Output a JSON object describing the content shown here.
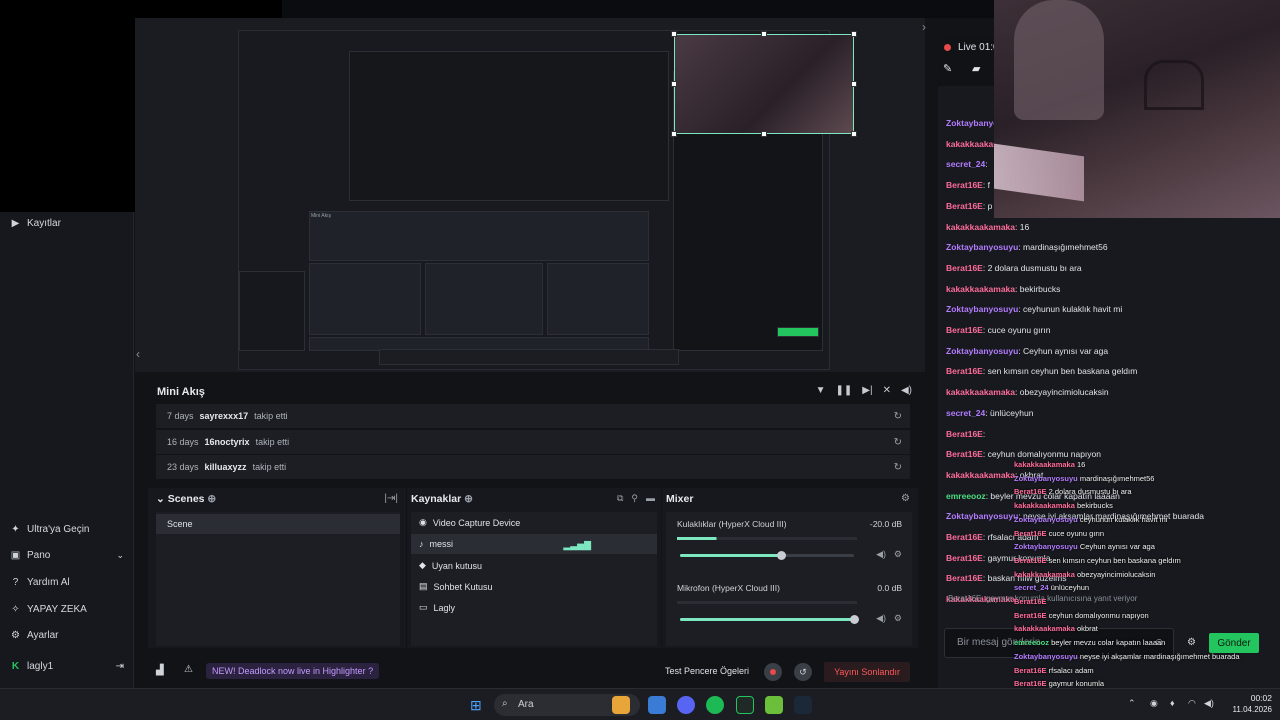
{
  "sidebar": {
    "recordings_label": "Kayıtlar",
    "items": [
      {
        "label": "Ultra'ya Geçin",
        "icon": "ultra-icon"
      },
      {
        "label": "Pano",
        "icon": "dashboard-icon"
      },
      {
        "label": "Yardım Al",
        "icon": "help-icon"
      },
      {
        "label": "YAPAY ZEKA",
        "icon": "ai-icon"
      },
      {
        "label": "Ayarlar",
        "icon": "gear-icon"
      }
    ],
    "user": "lagly1"
  },
  "mini_akis": {
    "title": "Mini Akış",
    "rows": [
      {
        "time": "7 days",
        "user": "sayrexxx17",
        "action": "takip etti"
      },
      {
        "time": "16 days",
        "user": "16noctyrix",
        "action": "takip etti"
      },
      {
        "time": "23 days",
        "user": "killuaxyzz",
        "action": "takip etti"
      }
    ]
  },
  "scenes": {
    "title": "Scenes",
    "items": [
      "Scene"
    ]
  },
  "sources": {
    "title": "Kaynaklar",
    "items": [
      "Video Capture Device",
      "messi",
      "Uyan kutusu",
      "Sohbet Kutusu",
      "Lagly"
    ]
  },
  "mixer": {
    "title": "Mixer",
    "channels": [
      {
        "name": "Kulaklıklar (HyperX Cloud III)",
        "value": "-20.0 dB",
        "level": 0.58
      },
      {
        "name": "Mikrofon (HyperX Cloud III)",
        "value": "0.0 dB",
        "level": 1.0
      }
    ]
  },
  "bottombar": {
    "news": "NEW! Deadlock now live in Highlighter ?",
    "test_label": "Test Pencere Ögeleri",
    "rec_label": "REC",
    "stop_label": "Yayını Sonlandır"
  },
  "chat": {
    "live_label": "Live",
    "live_time": "01:0",
    "messages": [
      {
        "user": "Zoktaybanyosuyu",
        "text": "",
        "color": "#b37cff"
      },
      {
        "user": "kakakkaakamaka",
        "text": "",
        "color": "#ff6b9a"
      },
      {
        "user": "secret_24",
        "text": "",
        "color": "#b37cff"
      },
      {
        "user": "Berat16E",
        "text": "f",
        "color": "#ff6b9a"
      },
      {
        "user": "Berat16E",
        "text": "p",
        "color": "#ff6b9a"
      },
      {
        "user": "kakakkaakamaka",
        "text": "16",
        "color": "#ff6b9a"
      },
      {
        "user": "Zoktaybanyosuyu",
        "text": "mardinaşığımehmet56",
        "color": "#b37cff"
      },
      {
        "user": "Berat16E",
        "text": "2 dolara dusmustu bı ara",
        "color": "#ff6b9a"
      },
      {
        "user": "kakakkaakamaka",
        "text": "bekirbucks",
        "color": "#ff6b9a"
      },
      {
        "user": "Zoktaybanyosuyu",
        "text": "ceyhunun kulaklık havit mi",
        "color": "#b37cff"
      },
      {
        "user": "Berat16E",
        "text": "cuce oyunu gırın",
        "color": "#ff6b9a"
      },
      {
        "user": "Zoktaybanyosuyu",
        "text": "Ceyhun aynısı var aga",
        "color": "#b37cff"
      },
      {
        "user": "Berat16E",
        "text": "sen kımsın ceyhun ben baskana geldım",
        "color": "#ff6b9a"
      },
      {
        "user": "kakakkaakamaka",
        "text": "obezyayincimiolucaksin",
        "color": "#ff6b9a"
      },
      {
        "user": "secret_24",
        "text": "ünlüceyhun",
        "color": "#b37cff"
      },
      {
        "user": "Berat16E",
        "text": "",
        "color": "#ff6b9a"
      },
      {
        "user": "Berat16E",
        "text": "ceyhun domalıyonmu napıyon",
        "color": "#ff6b9a"
      },
      {
        "user": "kakakkaakamaka",
        "text": "okbrat",
        "color": "#ff6b9a"
      },
      {
        "user": "emreeooz",
        "text": "beyler mevzu colar kapatın laaaan",
        "color": "#4ade80"
      },
      {
        "user": "Zoktaybanyosuyu",
        "text": "neyse iyi akşamlar mardinaşığımehmet buarada",
        "color": "#b37cff"
      },
      {
        "user": "Berat16E",
        "text": "rfsalacı adam",
        "color": "#ff6b9a"
      },
      {
        "user": "Berat16E",
        "text": "gaymur konumla",
        "color": "#ff6b9a"
      },
      {
        "user": "Berat16E",
        "text": "baskan hılw guzelms",
        "color": "#ff6b9a"
      },
      {
        "user": "kakakkaakamaka",
        "text": "",
        "color": "#ff6b9a"
      }
    ],
    "overlay": [
      {
        "user": "kakakkaakamaka",
        "text": "16",
        "color": "#ff6b9a"
      },
      {
        "user": "Zoktaybanyosuyu",
        "text": "mardinaşığımehmet56",
        "color": "#b37cff"
      },
      {
        "user": "Berat16E",
        "text": "2 dolara dusmustu bı ara",
        "color": "#ff6b9a"
      },
      {
        "user": "kakakkaakamaka",
        "text": "bekirbucks",
        "color": "#ff6b9a"
      },
      {
        "user": "Zoktaybanyosuyu",
        "text": "ceyhunun kulaklık havit mi",
        "color": "#b37cff"
      },
      {
        "user": "Berat16E",
        "text": "cuce oyunu gırın",
        "color": "#ff6b9a"
      },
      {
        "user": "Zoktaybanyosuyu",
        "text": "Ceyhun aynısı var aga",
        "color": "#b37cff"
      },
      {
        "user": "Berat16E",
        "text": "sen kımsın ceyhun ben baskana geldım",
        "color": "#ff6b9a"
      },
      {
        "user": "kakakkaakamaka",
        "text": "obezyayincimiolucaksin",
        "color": "#ff6b9a"
      },
      {
        "user": "secret_24",
        "text": "ünlüceyhun",
        "color": "#b37cff"
      },
      {
        "user": "Berat16E",
        "text": "",
        "color": "#ff6b9a"
      },
      {
        "user": "Berat16E",
        "text": "ceyhun domalıyonmu napıyon",
        "color": "#ff6b9a"
      },
      {
        "user": "kakakkaakamaka",
        "text": "okbrat",
        "color": "#ff6b9a"
      },
      {
        "user": "emreeooz",
        "text": "beyler mevzu colar kapatın laaaan",
        "color": "#4ade80"
      },
      {
        "user": "Zoktaybanyosuyu",
        "text": "neyse iyi akşamlar mardinaşığımehmet buarada",
        "color": "#b37cff"
      },
      {
        "user": "Berat16E",
        "text": "rfsalacı adam",
        "color": "#ff6b9a"
      },
      {
        "user": "Berat16E",
        "text": "gaymur konumla",
        "color": "#ff6b9a"
      },
      {
        "user": "Berat16E",
        "text": "baskan hılw guzelms",
        "color": "#ff6b9a"
      }
    ],
    "reply_hint": "Berat16E: gaymur konumla kullanıcısına yanıt veriyor",
    "input_placeholder": "Bir mesaj gönderin",
    "send_label": "Gönder"
  },
  "taskbar": {
    "search_label": "Ara",
    "time": "00:02",
    "date": "11.04.2026"
  },
  "colors": {
    "accent": "#7de8c0",
    "live": "#e64a4a",
    "send": "#22c55e"
  }
}
